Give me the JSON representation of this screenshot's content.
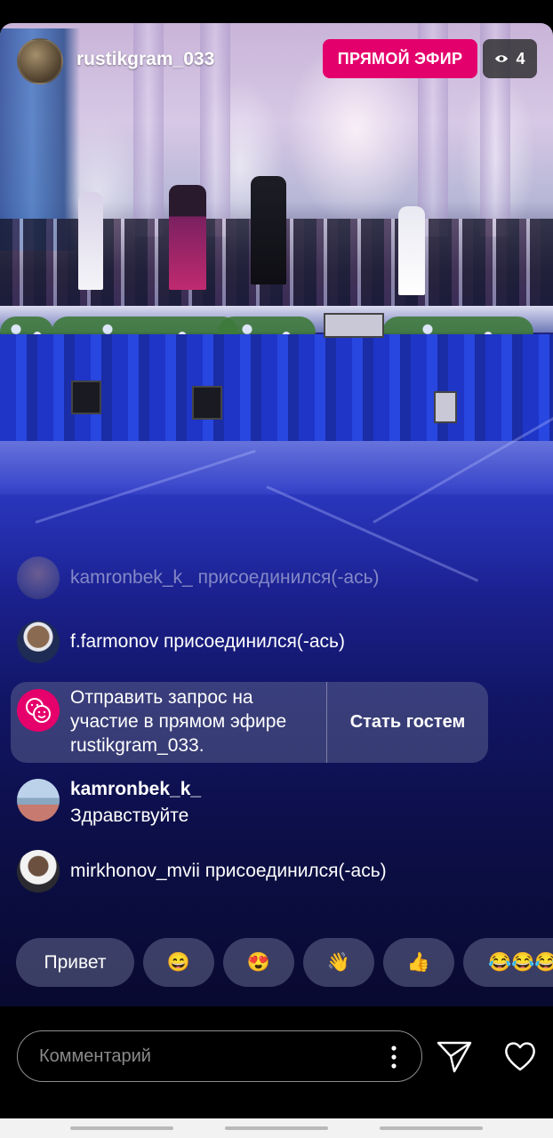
{
  "header": {
    "username": "rustikgram_033",
    "live_label": "ПРЯМОЙ ЭФИР",
    "viewer_count": "4"
  },
  "comments": [
    {
      "text": "kamronbek_k_ присоединился(-ась)"
    },
    {
      "text": "f.farmonov присоединился(-ась)"
    }
  ],
  "request": {
    "text": "Отправить запрос на участие в прямом эфире rustikgram_033.",
    "button": "Стать гостем"
  },
  "message": {
    "username": "kamronbek_k_",
    "text": "Здравствуйте"
  },
  "join_last": {
    "text": "mirkhonov_mvii присоединился(-ась)"
  },
  "quick_replies": [
    "Привет",
    "😄",
    "😍",
    "👋",
    "👍",
    "😂😂😂"
  ],
  "input": {
    "placeholder": "Комментарий"
  },
  "colors": {
    "live_badge": "#e4006c",
    "accent": "#e5006b"
  }
}
